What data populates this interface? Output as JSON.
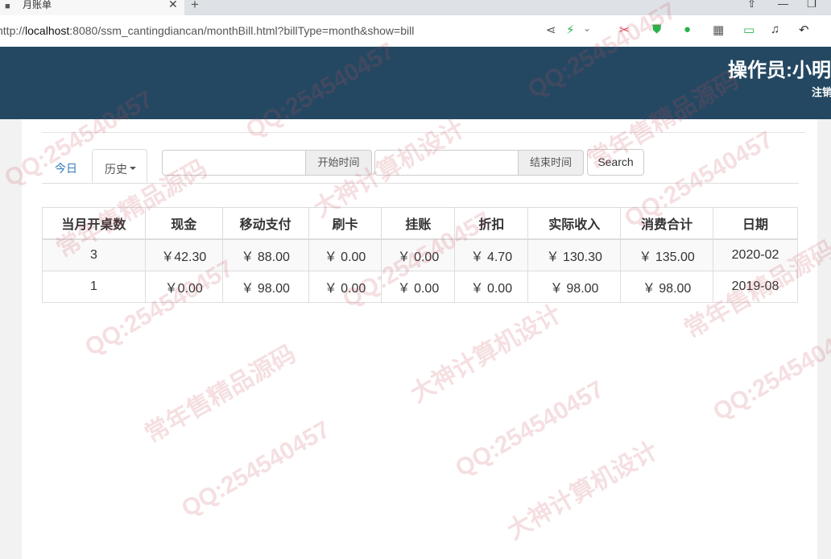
{
  "browser": {
    "tab_title": "月账单",
    "url_prefix": "http://",
    "url_host": "localhost",
    "url_rest": ":8080/ssm_cantingdiancan/monthBill.html?billType=month&show=bill"
  },
  "header": {
    "operator": "操作员:小明",
    "logout": "注销"
  },
  "nav": {
    "today": "今日",
    "history": "历史"
  },
  "filter": {
    "start_label": "开始时间",
    "end_label": "结束时间",
    "search": "Search"
  },
  "table": {
    "columns": [
      "当月开桌数",
      "现金",
      "移动支付",
      "刷卡",
      "挂账",
      "折扣",
      "实际收入",
      "消费合计",
      "日期"
    ],
    "rows": [
      [
        "3",
        "￥42.30",
        "￥ 88.00",
        "￥ 0.00",
        "￥ 0.00",
        "￥ 4.70",
        "￥ 130.30",
        "￥ 135.00",
        "2020-02"
      ],
      [
        "1",
        "￥0.00",
        "￥ 98.00",
        "￥ 0.00",
        "￥ 0.00",
        "￥ 0.00",
        "￥ 98.00",
        "￥ 98.00",
        "2019-08"
      ]
    ]
  },
  "watermarks": [
    "QQ:254540457",
    "大神计算机设计",
    "常年售精品源码"
  ]
}
